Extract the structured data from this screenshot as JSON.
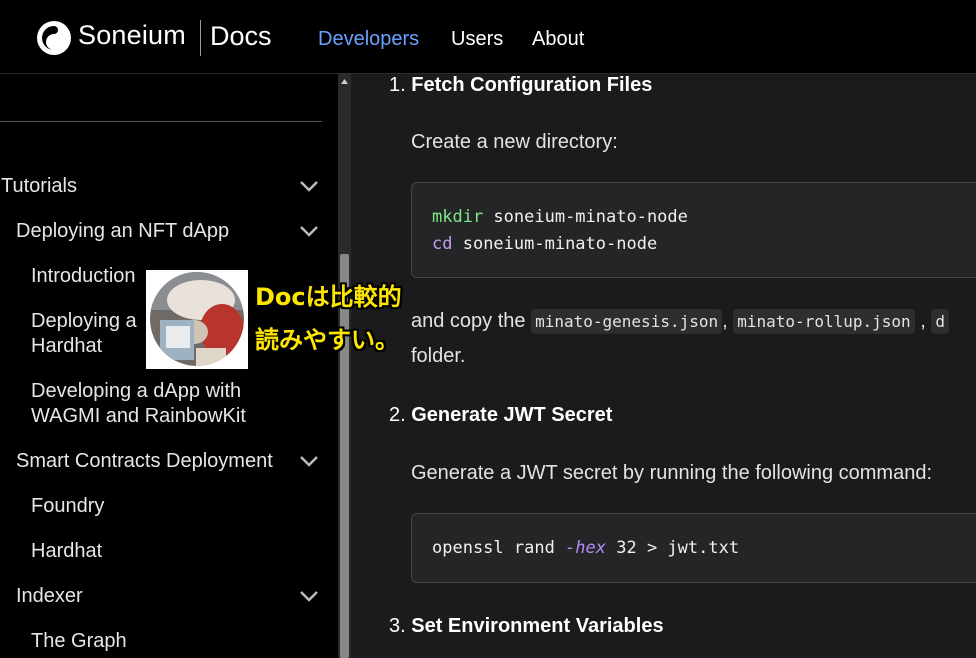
{
  "nav": {
    "brand": "Soneium",
    "brand_docs": "Docs",
    "links": [
      "Developers",
      "Users",
      "About"
    ]
  },
  "sidebar": {
    "items": [
      {
        "label": "Tutorials",
        "level": 0,
        "has_chevron": true
      },
      {
        "label": "Deploying an NFT dApp",
        "level": 1,
        "has_chevron": true
      },
      {
        "label": "Introduction",
        "level": 2,
        "has_chevron": false
      },
      {
        "label": "Deploying a",
        "label2": "Hardhat",
        "level": 2,
        "has_chevron": false
      },
      {
        "label": "Developing a dApp with",
        "label2": "WAGMI and RainbowKit",
        "level": 2,
        "has_chevron": false
      },
      {
        "label": "Smart Contracts Deployment",
        "level": 1,
        "has_chevron": true
      },
      {
        "label": "Foundry",
        "level": 2,
        "has_chevron": false
      },
      {
        "label": "Hardhat",
        "level": 2,
        "has_chevron": false
      },
      {
        "label": "Indexer",
        "level": 1,
        "has_chevron": true
      },
      {
        "label": "The Graph",
        "level": 2,
        "has_chevron": false
      }
    ]
  },
  "content": {
    "step1": {
      "num": "1.",
      "title": "Fetch Configuration Files"
    },
    "step1_para": "Create a new directory:",
    "code1": {
      "line1_cmd": "mkdir",
      "line1_arg": " soneium-minato-node",
      "line2_cmd": "cd",
      "line2_arg": " soneium-minato-node"
    },
    "step1_para2_pre": "and copy the ",
    "step1_code_a": "minato-genesis.json",
    "step1_comma1": ",",
    "step1_code_b": "minato-rollup.json",
    "step1_comma2": " ,",
    "step1_code_c": "d",
    "step1_para2_end": "folder.",
    "step2": {
      "num": "2.",
      "title": "Generate JWT Secret"
    },
    "step2_para": "Generate a JWT secret by running the following command:",
    "code2": {
      "pre": "openssl rand ",
      "flag": "-hex",
      "post": " 32 > jwt.txt"
    },
    "step3": {
      "num": "3.",
      "title": "Set Environment Variables"
    }
  },
  "overlay": {
    "line1": "Docは比較的",
    "line2": "読みやすい。"
  },
  "colors": {
    "accent": "#6aa1ff",
    "overlay_text": "#ffe600"
  }
}
